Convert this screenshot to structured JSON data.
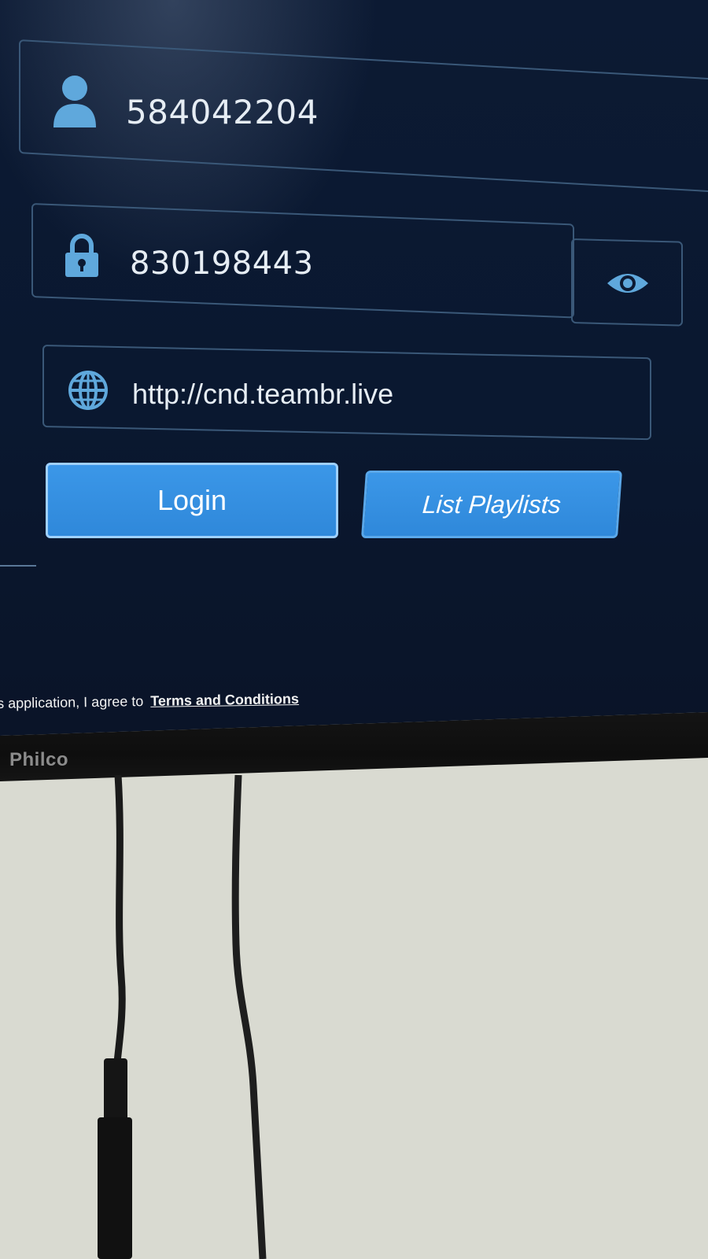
{
  "login_form": {
    "username": {
      "value": "584042204",
      "icon": "user-icon"
    },
    "password": {
      "value": "830198443",
      "icon": "lock-icon",
      "toggle_icon": "eye-icon"
    },
    "server": {
      "value": "http://cnd.teambr.live",
      "icon": "globe-icon"
    }
  },
  "buttons": {
    "login_label": "Login",
    "list_playlists_label": "List Playlists"
  },
  "footer": {
    "terms_prefix": "s application, I agree to",
    "terms_link": "Terms and Conditions"
  },
  "tv": {
    "brand": "Philco"
  },
  "colors": {
    "screen_bg": "#0c1a33",
    "accent": "#3b97e8",
    "icon": "#5fa8dc",
    "field_border": "#3a5878"
  }
}
